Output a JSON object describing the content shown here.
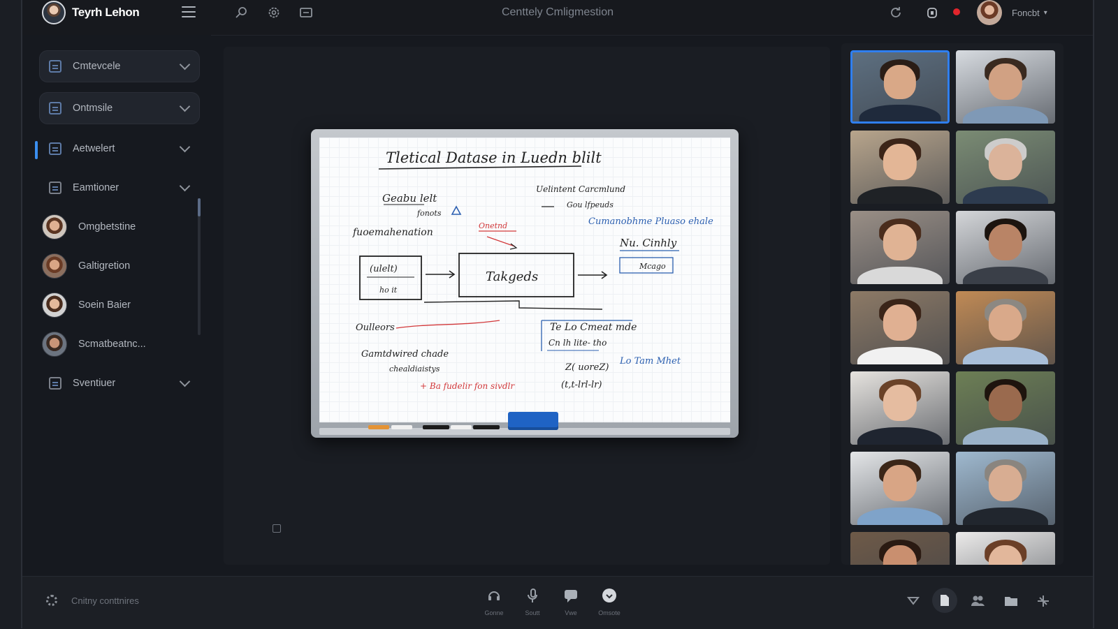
{
  "app": {
    "brand_name": "Teyrh Lehon",
    "window_title": "Centtely Cmligmestion",
    "user_name": "Foncbt"
  },
  "colors": {
    "accent": "#2f7ff0",
    "recording": "#e2252c",
    "background": "#16191f"
  },
  "top_tools": [
    "search-user-icon",
    "settings-icon",
    "share-screen-icon"
  ],
  "top_right_icons": [
    "refresh-icon",
    "lock-icon",
    "recording-dot"
  ],
  "sidebar": {
    "items": [
      {
        "label": "Cmtevcele",
        "kind": "section"
      },
      {
        "label": "Ontmsile",
        "kind": "section"
      },
      {
        "label": "Aetwelert",
        "kind": "section",
        "active": true
      },
      {
        "label": "Eamtioner",
        "kind": "section"
      },
      {
        "label": "Omgbetstine",
        "kind": "person"
      },
      {
        "label": "Galtigretion",
        "kind": "person"
      },
      {
        "label": "Soein Baier",
        "kind": "person"
      },
      {
        "label": "Scmatbeatnc...",
        "kind": "person"
      },
      {
        "label": "Sventiuer",
        "kind": "section"
      }
    ]
  },
  "whiteboard": {
    "title": "Tletical Datase in Luedn blilt",
    "notes": [
      "Geabu lelt",
      "fonots",
      "fuoemahenation",
      "Onetnd",
      "Uelintent Carcmlund",
      "Gou lfpeuds",
      "Cumanobhme Pluaso ehale",
      "Nu. Cinhly",
      "Mcago",
      "(ulelt)",
      "ho it",
      "Takgeds",
      "Oulleors",
      "Gamtdwired chade",
      "chealdiaistys",
      "Te Lo Cmeat mde",
      "Cn lh lite- tho",
      "Lo Tam Mhet",
      "Z( uoreZ)",
      "(t,t-lrl-lr)",
      "+ Ba fudelir fon sivdlr"
    ]
  },
  "participants": [
    {
      "skin": "#d9a887",
      "hair": "#2a1d16",
      "shirt": "#1f2a3c",
      "bg": "#5d6f80",
      "active": true
    },
    {
      "skin": "#d1a183",
      "hair": "#3a2a20",
      "shirt": "#7f99b6",
      "bg": "#d7dbe0"
    },
    {
      "skin": "#e3b696",
      "hair": "#3b2418",
      "shirt": "#1f2226",
      "bg": "#b8a58c"
    },
    {
      "skin": "#dbb39a",
      "hair": "#cdcccb",
      "shirt": "#2d3b4f",
      "bg": "#7b8c74"
    },
    {
      "skin": "#e0b394",
      "hair": "#4a2c1c",
      "shirt": "#d9d9d9",
      "bg": "#9a8f86"
    },
    {
      "skin": "#b98466",
      "hair": "#1c140f",
      "shirt": "#3a3f48",
      "bg": "#d4d6d9"
    },
    {
      "skin": "#e0b092",
      "hair": "#3a2418",
      "shirt": "#f1f1f1",
      "bg": "#8d7a66"
    },
    {
      "skin": "#d9a98a",
      "hair": "#8c8882",
      "shirt": "#a9bfd9",
      "bg": "#c08a55"
    },
    {
      "skin": "#e5bca0",
      "hair": "#6a4228",
      "shirt": "#1f2530",
      "bg": "#e6e3df"
    },
    {
      "skin": "#9a6a4e",
      "hair": "#1e140e",
      "shirt": "#9bb2c9",
      "bg": "#6d7f55"
    },
    {
      "skin": "#d8a585",
      "hair": "#3b2618",
      "shirt": "#7fa3c9",
      "bg": "#e4e6e8"
    },
    {
      "skin": "#d8ad92",
      "hair": "#8a857f",
      "shirt": "#21262e",
      "bg": "#9fb9cf"
    },
    {
      "skin": "#c98f6f",
      "hair": "#2a1a12",
      "shirt": "#3a3330",
      "bg": "#6e5a48"
    },
    {
      "skin": "#e2b79b",
      "hair": "#6b3f27",
      "shirt": "#ddd2c5",
      "bg": "#ecebea"
    }
  ],
  "bottom": {
    "status": "Cnitny conttnires",
    "controls": [
      {
        "label": "Gonne",
        "icon": "audio-icon"
      },
      {
        "label": "Soutt",
        "icon": "microphone-icon"
      },
      {
        "label": "Vwe",
        "icon": "chat-icon"
      },
      {
        "label": "Omsote",
        "icon": "reaction-icon"
      }
    ],
    "right_icons": [
      "shield-icon",
      "document-icon",
      "people-icon",
      "folder-icon",
      "more-icon"
    ]
  }
}
